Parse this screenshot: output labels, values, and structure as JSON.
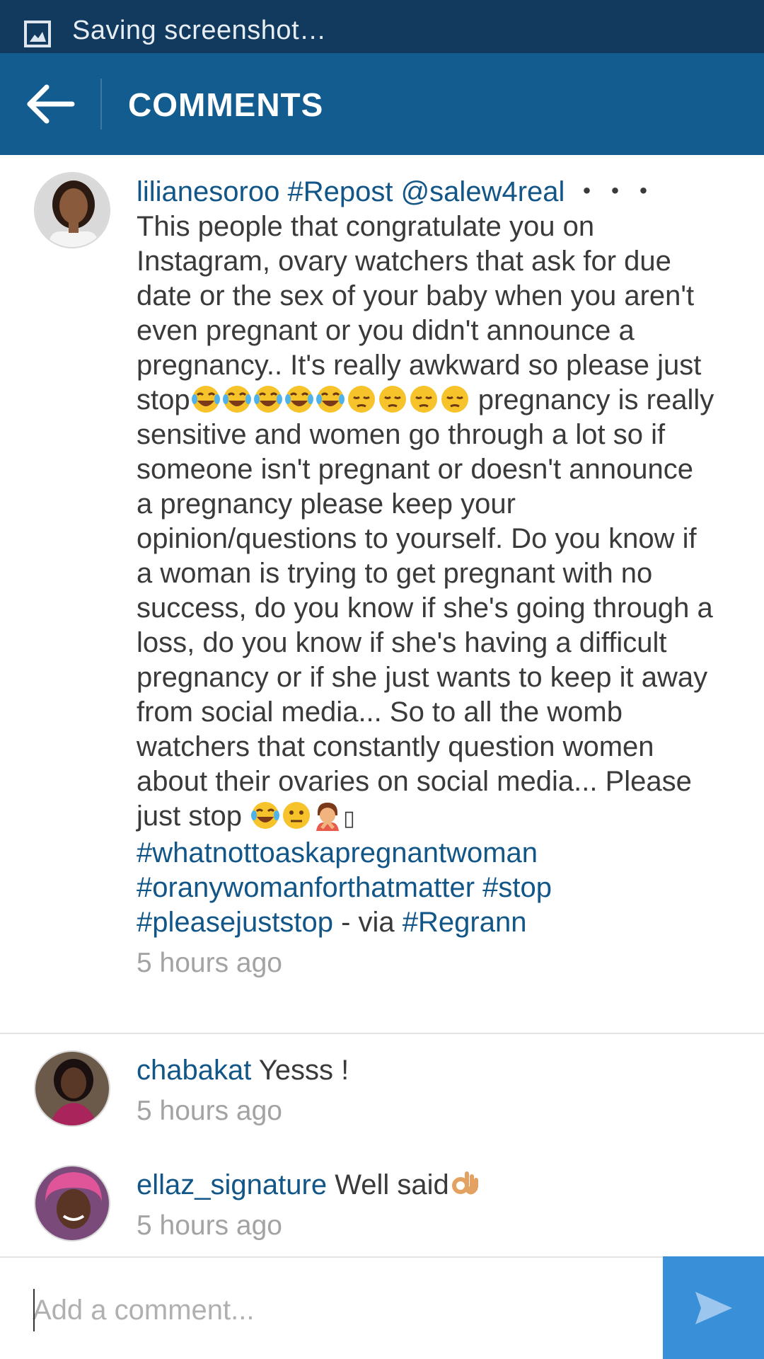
{
  "status_bar": {
    "text": "Saving screenshot…"
  },
  "app_bar": {
    "title": "COMMENTS"
  },
  "comments": [
    {
      "username": "lilianesoroo",
      "tag1": "#Repost",
      "mention": "@salew4real",
      "text1": " ・・・ This people that congratulate you on Instagram, ovary watchers that ask for due date or the sex of your baby when you aren't even pregnant or you didn't announce a pregnancy.. It's really awkward so please just stop",
      "text2": "pregnancy is really sensitive and women go through a lot so if someone isn't pregnant or doesn't announce a pregnancy please keep your opinion/questions to yourself. Do you know if a woman is trying to get pregnant with no success, do you know if she's going through a loss, do you know if she's having a difficult pregnancy or if she just wants to keep it away from social media... So to all the womb watchers that constantly question women about their ovaries on social media... Please just stop ",
      "tag2": "#whatnottoaskapregnantwoman",
      "tag3": "#oranywomanforthatmatter",
      "tag4": "#stop",
      "tag5": "#pleasejuststop",
      "via": " - via ",
      "tag6": "#Regrann",
      "time": "5 hours ago"
    },
    {
      "username": "chabakat",
      "text": "Yesss !",
      "time": "5 hours ago"
    },
    {
      "username": "ellaz_signature",
      "text": "Well said",
      "time": "5 hours ago"
    }
  ],
  "input": {
    "placeholder": "Add a comment..."
  },
  "colors": {
    "status_bar": "#123a5e",
    "app_bar": "#135c8f",
    "link": "#125688",
    "send": "#3a8fd9"
  },
  "icons": [
    "image-icon",
    "back-arrow-icon",
    "send-icon",
    "tears-of-joy-emoji",
    "pensive-emoji",
    "neutral-face-emoji",
    "person-gesturing-emoji",
    "ok-hand-emoji"
  ]
}
